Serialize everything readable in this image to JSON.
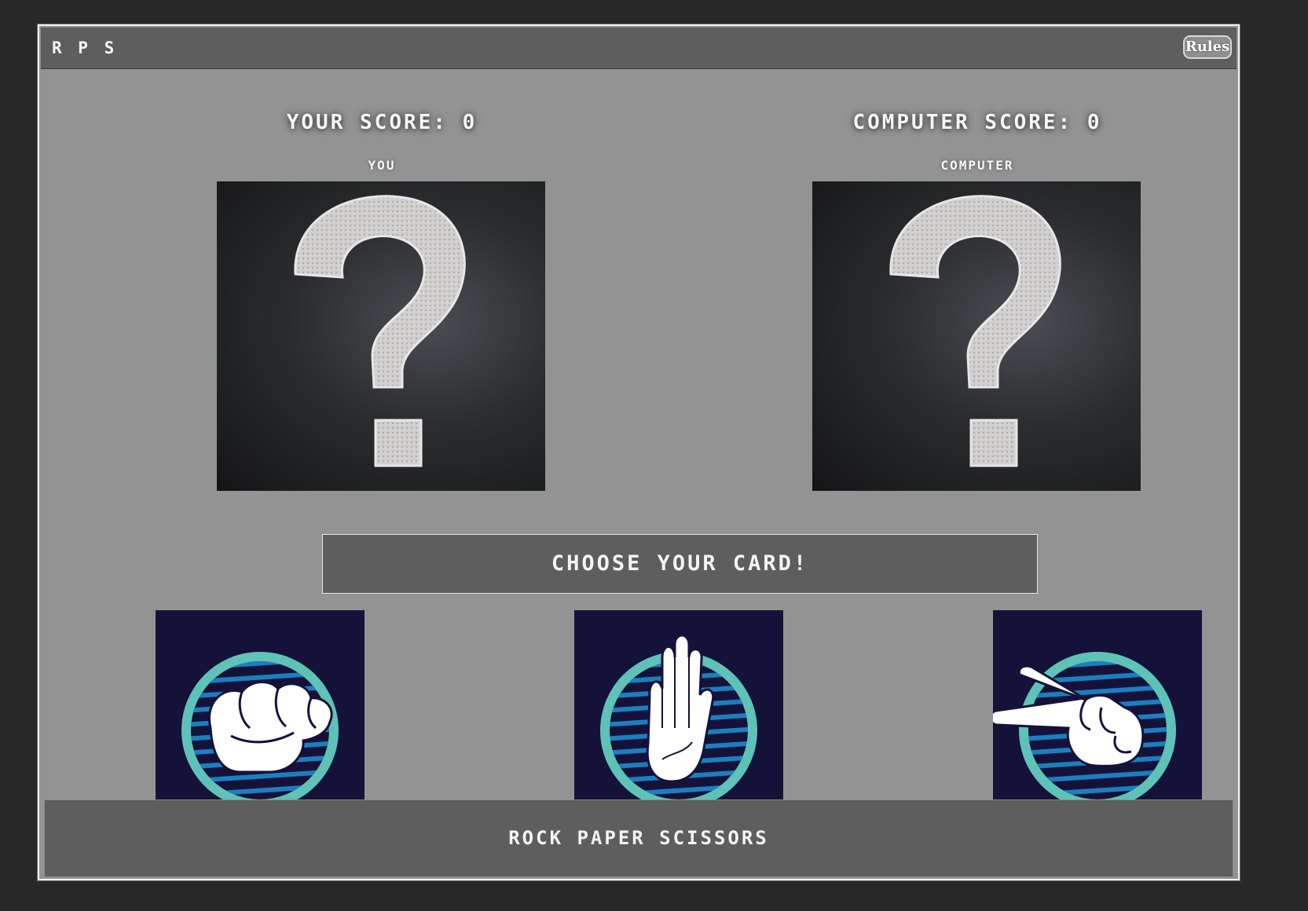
{
  "header": {
    "brand": "R P S",
    "rules_label": "Rules"
  },
  "scores": {
    "player": "YOUR SCORE: 0",
    "computer": "COMPUTER SCORE: 0"
  },
  "players": {
    "player_label": "YOU",
    "computer_label": "COMPUTER",
    "player_choice_icon": "question-mark-icon",
    "computer_choice_icon": "question-mark-icon"
  },
  "prompt": "CHOOSE YOUR CARD!",
  "cards": [
    {
      "id": "rock",
      "icon": "rock-fist-icon"
    },
    {
      "id": "paper",
      "icon": "paper-hand-icon"
    },
    {
      "id": "scissors",
      "icon": "scissors-hand-icon"
    }
  ],
  "footer": "ROCK PAPER SCISSORS",
  "colors": {
    "page_bg": "#282828",
    "panel_bg": "#939393",
    "bar_bg": "#5e5e5e",
    "card_bg": "#15123a",
    "card_ring": "#5ec2b7",
    "card_stripes": "#1b7fbf"
  }
}
